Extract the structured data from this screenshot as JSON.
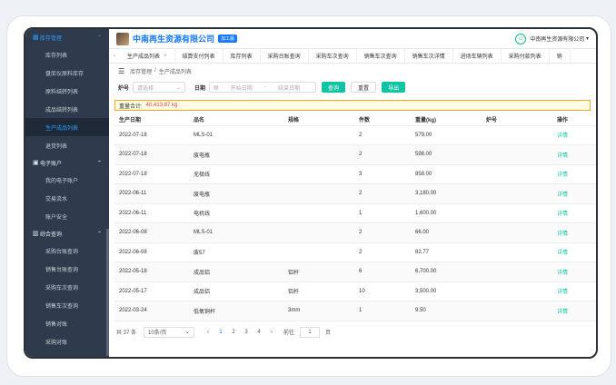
{
  "sidebar": {
    "groups": [
      {
        "label": "库存管理",
        "icon": "",
        "items": [
          "库存列表",
          "盘库仪原料库存",
          "原料结转列表",
          "成品结转列表",
          "生产成品列表",
          "退货列表"
        ]
      },
      {
        "label": "电子账户",
        "icon": "",
        "items": [
          "我的电子账户",
          "交易流水",
          "账户安全"
        ]
      },
      {
        "label": "综合查询",
        "icon": "",
        "items": [
          "采购台账查询",
          "销售台账查询",
          "采购车次查询",
          "销售车次查询",
          "销售对账",
          "采购对账"
        ]
      }
    ]
  },
  "header": {
    "company": "中南再生资源有限公司",
    "badge": "加工版",
    "user": "中南再生资源有限公司"
  },
  "tabs": [
    "生产成品列表",
    "结算支付列表",
    "库存列表",
    "采购台账查询",
    "采购车次查询",
    "销售车次查询",
    "销售车次详情",
    "进场车辆列表",
    "采购付款列表",
    "销"
  ],
  "breadcrumb": {
    "parent": "库存管理",
    "sep": "/",
    "current": "生产成品列表"
  },
  "filters": {
    "furnace_label": "炉号",
    "furnace_placeholder": "请选择",
    "date_label": "日期",
    "start_placeholder": "开始日期",
    "range_sep": "-",
    "end_placeholder": "结束日期",
    "query_btn": "查询",
    "reset_btn": "重置",
    "export_btn": "导出"
  },
  "summary": {
    "label": "重量合计:",
    "value": "40,413.87 kg"
  },
  "table": {
    "headers": [
      "生产日期",
      "品名",
      "规格",
      "件数",
      "重量(kg)",
      "炉号",
      "操作"
    ],
    "rows": [
      [
        "2022-07-18",
        "MLS-01",
        "",
        "2",
        "579.00",
        "",
        "详情"
      ],
      [
        "2022-07-18",
        "废电瓶",
        "",
        "2",
        "598.00",
        "",
        "详情"
      ],
      [
        "2022-07-18",
        "无极线",
        "",
        "3",
        "858.00",
        "",
        "详情"
      ],
      [
        "2022-06-11",
        "废电瓶",
        "",
        "2",
        "3,180.00",
        "",
        "详情"
      ],
      [
        "2022-06-11",
        "电机线",
        "",
        "1",
        "1,600.00",
        "",
        "详情"
      ],
      [
        "2022-06-08",
        "MLS-01",
        "",
        "2",
        "66.00",
        "",
        "详情"
      ],
      [
        "2022-06-08",
        "废57",
        "",
        "2",
        "82.77",
        "",
        "详情"
      ],
      [
        "2022-05-18",
        "成品铝",
        "铝杆",
        "6",
        "6,700.00",
        "",
        "详情"
      ],
      [
        "2022-05-17",
        "成品铝",
        "铝杆",
        "10",
        "3,500.00",
        "",
        "详情"
      ],
      [
        "2022-03-24",
        "低氧铜杆",
        "3mm",
        "1",
        "9.50",
        "",
        "详情"
      ]
    ]
  },
  "pager": {
    "total": "共 37 条",
    "size": "10条/页",
    "pages": [
      "1",
      "2",
      "3",
      "4"
    ],
    "goto_label": "前往",
    "goto_value": "1",
    "page_unit": "页"
  }
}
